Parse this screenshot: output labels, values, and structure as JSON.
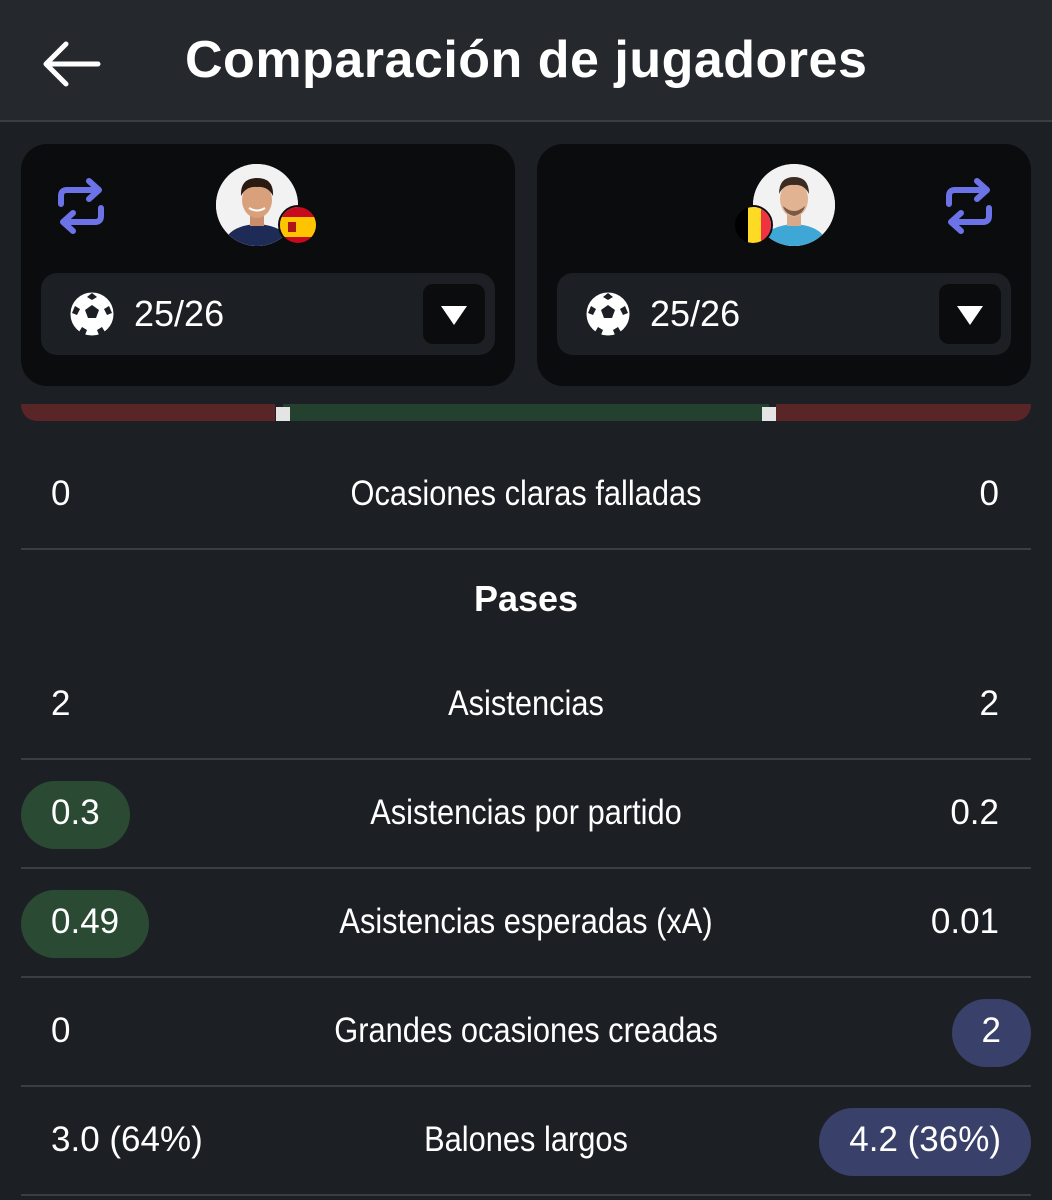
{
  "header": {
    "title": "Comparación de jugadores"
  },
  "players": [
    {
      "season": "25/26",
      "flag": "spain-flag",
      "competition_icon": "soccer-ball-icon"
    },
    {
      "season": "25/26",
      "flag": "belgium-flag",
      "competition_icon": "soccer-ball-icon"
    }
  ],
  "colors": {
    "accent_swap": "#6c73e6",
    "better_left": "#2a4a33",
    "better_right": "#39406a",
    "bar_red": "#5a2526",
    "bar_green": "#244130"
  },
  "stats_top": [
    {
      "label": "Ocasiones claras falladas",
      "left": "0",
      "right": "0"
    }
  ],
  "section_passes": {
    "title": "Pases",
    "rows": [
      {
        "label": "Asistencias",
        "left": "2",
        "right": "2"
      },
      {
        "label": "Asistencias por partido",
        "left": "0.3",
        "right": "0.2"
      },
      {
        "label": "Asistencias esperadas (xA)",
        "left": "0.49",
        "right": "0.01"
      },
      {
        "label": "Grandes ocasiones creadas",
        "left": "0",
        "right": "2"
      },
      {
        "label": "Balones largos",
        "left": "3.0 (64%)",
        "right": "4.2 (36%)"
      }
    ]
  }
}
